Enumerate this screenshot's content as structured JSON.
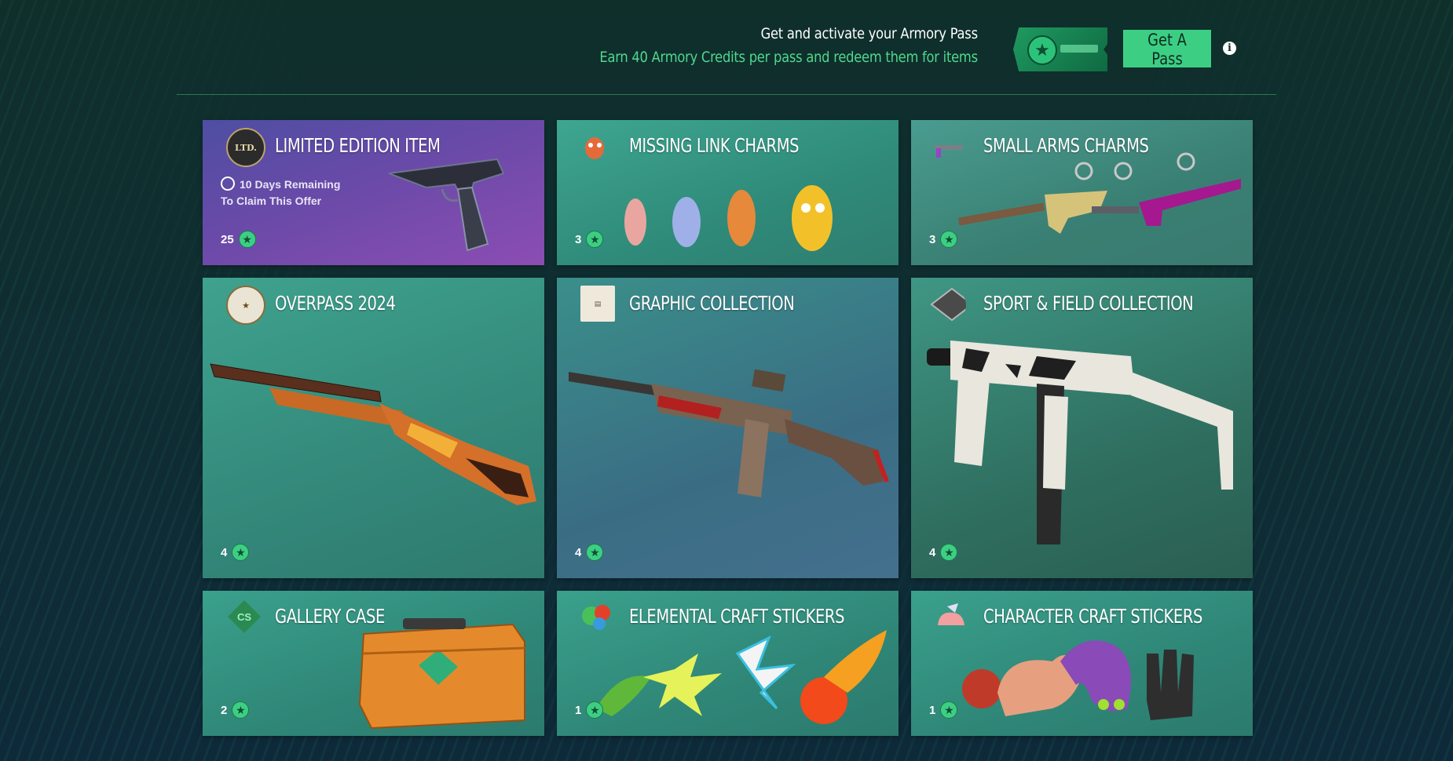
{
  "promo": {
    "title": "Get and activate your Armory Pass",
    "subtitle": "Earn 40 Armory Credits per pass and redeem them for items",
    "button_label": "Get A Pass",
    "info_glyph": "i"
  },
  "colors": {
    "accent": "#3ccf83",
    "subtitle_green": "#4fd98e"
  },
  "cards": [
    {
      "title": "LIMITED EDITION ITEM",
      "cost": "25",
      "badge": "LTD.",
      "remaining_line1": "10 Days Remaining",
      "remaining_line2": "To Claim This Offer",
      "icon": "limited-edition-badge-icon"
    },
    {
      "title": "MISSING LINK CHARMS",
      "cost": "3",
      "icon": "missing-link-charm-icon"
    },
    {
      "title": "SMALL ARMS CHARMS",
      "cost": "3",
      "icon": "small-arms-charm-icon"
    },
    {
      "title": "OVERPASS 2024",
      "cost": "4",
      "icon": "overpass-collection-icon"
    },
    {
      "title": "GRAPHIC COLLECTION",
      "cost": "4",
      "icon": "graphic-collection-icon"
    },
    {
      "title": "SPORT & FIELD COLLECTION",
      "cost": "4",
      "icon": "sport-field-collection-icon"
    },
    {
      "title": "GALLERY CASE",
      "cost": "2",
      "badge": "CS",
      "icon": "cs-case-icon"
    },
    {
      "title": "ELEMENTAL CRAFT STICKERS",
      "cost": "1",
      "icon": "elemental-sticker-icon"
    },
    {
      "title": "CHARACTER CRAFT STICKERS",
      "cost": "1",
      "icon": "character-sticker-icon"
    }
  ]
}
